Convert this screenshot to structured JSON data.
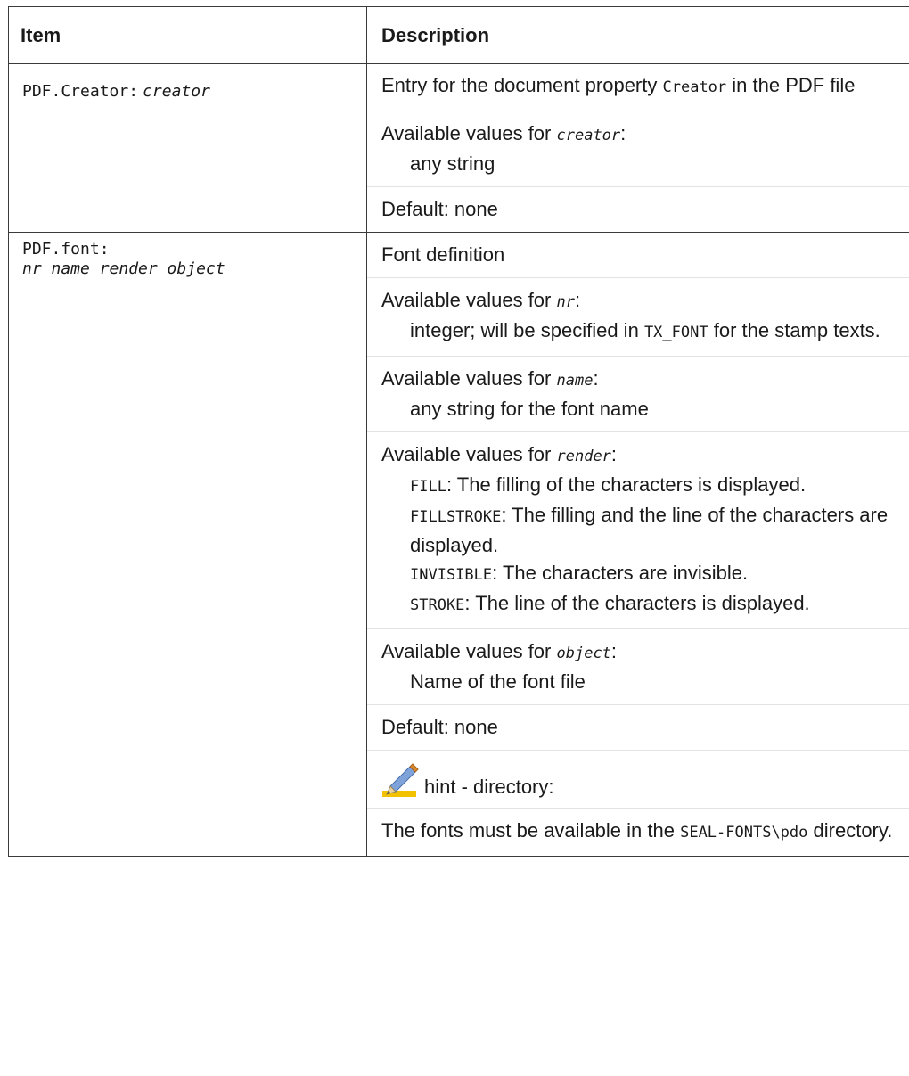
{
  "table": {
    "headers": {
      "item": "Item",
      "description": "Description"
    },
    "rows": [
      {
        "item": {
          "code": "PDF.Creator:",
          "param": "creator"
        },
        "desc": {
          "entry_pre": "Entry for the document property",
          "entry_code": "Creator",
          "entry_post": "in the PDF file",
          "available_pre": "Available values for",
          "available_param": "creator",
          "available_colon": ":",
          "value": "any string",
          "default": "Default: none"
        }
      },
      {
        "item": {
          "code": "PDF.font:",
          "params": "nr name render object"
        },
        "desc": {
          "title": "Font definition",
          "nr_pre": "Available values for",
          "nr_param": "nr",
          "nr_colon": ":",
          "nr_value_pre": "integer; will be specified in",
          "nr_value_code": "TX_FONT",
          "nr_value_post": "for the stamp texts.",
          "name_pre": "Available values for",
          "name_param": "name",
          "name_colon": ":",
          "name_value": "any string for the font name",
          "render_pre": "Available values for",
          "render_param": "render",
          "render_colon": ":",
          "render_options": [
            {
              "code": "FILL",
              "text": ": The filling of the characters is displayed."
            },
            {
              "code": "FILLSTROKE",
              "text": ": The filling and the line of the characters are displayed."
            },
            {
              "code": "INVISIBLE",
              "text": ": The characters are invisible."
            },
            {
              "code": "STROKE",
              "text": ": The line of the characters is displayed."
            }
          ],
          "object_pre": "Available values for",
          "object_param": "object",
          "object_colon": ":",
          "object_value": "Name of the font file",
          "default": "Default: none",
          "hint_icon": "pencil-icon",
          "hint_label": "hint - directory:",
          "fonts_pre": "The fonts must be available in the",
          "fonts_code": "SEAL-FONTS\\pdo",
          "fonts_post": "directory."
        }
      }
    ]
  }
}
